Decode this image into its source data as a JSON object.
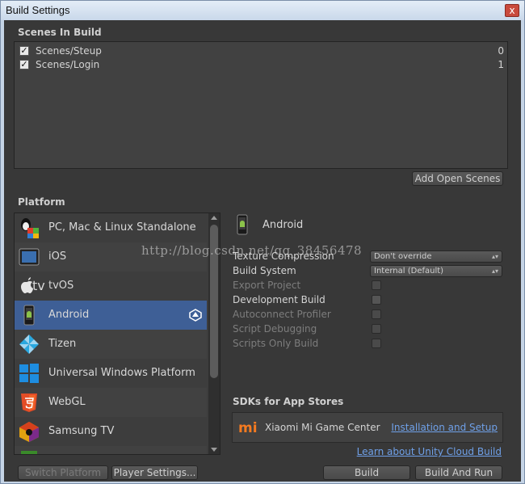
{
  "window": {
    "title": "Build Settings",
    "close_glyph": "x"
  },
  "scenes": {
    "header": "Scenes In Build",
    "items": [
      {
        "name": "Scenes/Steup",
        "index": "0",
        "checked": true
      },
      {
        "name": "Scenes/Login",
        "index": "1",
        "checked": true
      }
    ],
    "add_open_scenes_label": "Add Open Scenes"
  },
  "platform": {
    "header": "Platform",
    "items": [
      {
        "label": "PC, Mac & Linux Standalone",
        "icon": "pc-mac-linux-icon"
      },
      {
        "label": "iOS",
        "icon": "ios-icon"
      },
      {
        "label": "tvOS",
        "icon": "tvos-icon"
      },
      {
        "label": "Android",
        "icon": "android-icon",
        "selected": true
      },
      {
        "label": "Tizen",
        "icon": "tizen-icon"
      },
      {
        "label": "Universal Windows Platform",
        "icon": "windows-icon"
      },
      {
        "label": "WebGL",
        "icon": "html5-icon"
      },
      {
        "label": "Samsung TV",
        "icon": "samsung-tv-icon"
      }
    ],
    "tv_glyph": "tv"
  },
  "settings": {
    "title": "Android",
    "texture_compression": {
      "label": "Texture Compression",
      "value": "Don't override"
    },
    "build_system": {
      "label": "Build System",
      "value": "Internal (Default)"
    },
    "export_project": {
      "label": "Export Project",
      "enabled": false
    },
    "development_build": {
      "label": "Development Build",
      "enabled": true
    },
    "autoconnect_profiler": {
      "label": "Autoconnect Profiler",
      "enabled": false
    },
    "script_debugging": {
      "label": "Script Debugging",
      "enabled": false
    },
    "scripts_only_build": {
      "label": "Scripts Only Build",
      "enabled": false
    },
    "dropdown_arrows": "▴▾"
  },
  "sdks": {
    "header": "SDKs for App Stores",
    "item": {
      "name": "Xiaomi Mi Game Center",
      "link": "Installation and Setup",
      "logo_text": "mi"
    }
  },
  "cloud_build_link": "Learn about Unity Cloud Build",
  "buttons": {
    "switch_platform": "Switch Platform",
    "player_settings": "Player Settings...",
    "build": "Build",
    "build_and_run": "Build And Run"
  },
  "watermark": "http://blog.csdn.net/qq_38456478",
  "colors": {
    "selected_row": "#3e5f96",
    "link": "#6fa0e8",
    "panel": "#383838"
  }
}
